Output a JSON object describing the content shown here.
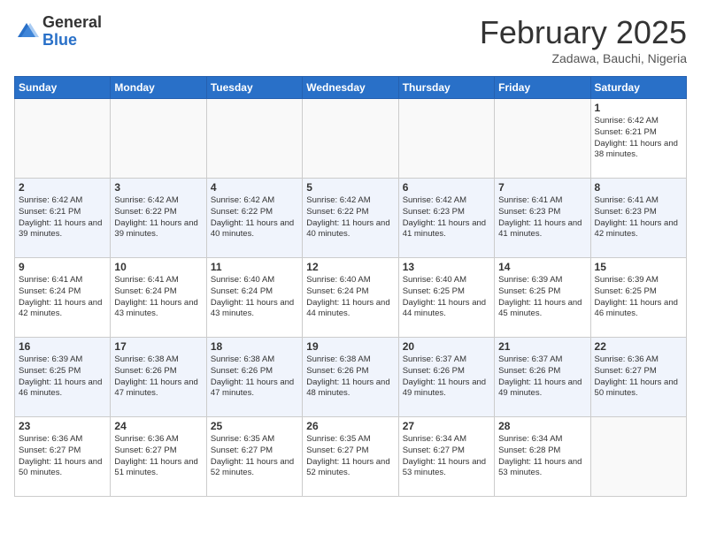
{
  "header": {
    "logo_general": "General",
    "logo_blue": "Blue",
    "month_title": "February 2025",
    "subtitle": "Zadawa, Bauchi, Nigeria"
  },
  "days_of_week": [
    "Sunday",
    "Monday",
    "Tuesday",
    "Wednesday",
    "Thursday",
    "Friday",
    "Saturday"
  ],
  "weeks": [
    {
      "alt": false,
      "days": [
        {
          "num": "",
          "info": ""
        },
        {
          "num": "",
          "info": ""
        },
        {
          "num": "",
          "info": ""
        },
        {
          "num": "",
          "info": ""
        },
        {
          "num": "",
          "info": ""
        },
        {
          "num": "",
          "info": ""
        },
        {
          "num": "1",
          "info": "Sunrise: 6:42 AM\nSunset: 6:21 PM\nDaylight: 11 hours and 38 minutes."
        }
      ]
    },
    {
      "alt": true,
      "days": [
        {
          "num": "2",
          "info": "Sunrise: 6:42 AM\nSunset: 6:21 PM\nDaylight: 11 hours and 39 minutes."
        },
        {
          "num": "3",
          "info": "Sunrise: 6:42 AM\nSunset: 6:22 PM\nDaylight: 11 hours and 39 minutes."
        },
        {
          "num": "4",
          "info": "Sunrise: 6:42 AM\nSunset: 6:22 PM\nDaylight: 11 hours and 40 minutes."
        },
        {
          "num": "5",
          "info": "Sunrise: 6:42 AM\nSunset: 6:22 PM\nDaylight: 11 hours and 40 minutes."
        },
        {
          "num": "6",
          "info": "Sunrise: 6:42 AM\nSunset: 6:23 PM\nDaylight: 11 hours and 41 minutes."
        },
        {
          "num": "7",
          "info": "Sunrise: 6:41 AM\nSunset: 6:23 PM\nDaylight: 11 hours and 41 minutes."
        },
        {
          "num": "8",
          "info": "Sunrise: 6:41 AM\nSunset: 6:23 PM\nDaylight: 11 hours and 42 minutes."
        }
      ]
    },
    {
      "alt": false,
      "days": [
        {
          "num": "9",
          "info": "Sunrise: 6:41 AM\nSunset: 6:24 PM\nDaylight: 11 hours and 42 minutes."
        },
        {
          "num": "10",
          "info": "Sunrise: 6:41 AM\nSunset: 6:24 PM\nDaylight: 11 hours and 43 minutes."
        },
        {
          "num": "11",
          "info": "Sunrise: 6:40 AM\nSunset: 6:24 PM\nDaylight: 11 hours and 43 minutes."
        },
        {
          "num": "12",
          "info": "Sunrise: 6:40 AM\nSunset: 6:24 PM\nDaylight: 11 hours and 44 minutes."
        },
        {
          "num": "13",
          "info": "Sunrise: 6:40 AM\nSunset: 6:25 PM\nDaylight: 11 hours and 44 minutes."
        },
        {
          "num": "14",
          "info": "Sunrise: 6:39 AM\nSunset: 6:25 PM\nDaylight: 11 hours and 45 minutes."
        },
        {
          "num": "15",
          "info": "Sunrise: 6:39 AM\nSunset: 6:25 PM\nDaylight: 11 hours and 46 minutes."
        }
      ]
    },
    {
      "alt": true,
      "days": [
        {
          "num": "16",
          "info": "Sunrise: 6:39 AM\nSunset: 6:25 PM\nDaylight: 11 hours and 46 minutes."
        },
        {
          "num": "17",
          "info": "Sunrise: 6:38 AM\nSunset: 6:26 PM\nDaylight: 11 hours and 47 minutes."
        },
        {
          "num": "18",
          "info": "Sunrise: 6:38 AM\nSunset: 6:26 PM\nDaylight: 11 hours and 47 minutes."
        },
        {
          "num": "19",
          "info": "Sunrise: 6:38 AM\nSunset: 6:26 PM\nDaylight: 11 hours and 48 minutes."
        },
        {
          "num": "20",
          "info": "Sunrise: 6:37 AM\nSunset: 6:26 PM\nDaylight: 11 hours and 49 minutes."
        },
        {
          "num": "21",
          "info": "Sunrise: 6:37 AM\nSunset: 6:26 PM\nDaylight: 11 hours and 49 minutes."
        },
        {
          "num": "22",
          "info": "Sunrise: 6:36 AM\nSunset: 6:27 PM\nDaylight: 11 hours and 50 minutes."
        }
      ]
    },
    {
      "alt": false,
      "days": [
        {
          "num": "23",
          "info": "Sunrise: 6:36 AM\nSunset: 6:27 PM\nDaylight: 11 hours and 50 minutes."
        },
        {
          "num": "24",
          "info": "Sunrise: 6:36 AM\nSunset: 6:27 PM\nDaylight: 11 hours and 51 minutes."
        },
        {
          "num": "25",
          "info": "Sunrise: 6:35 AM\nSunset: 6:27 PM\nDaylight: 11 hours and 52 minutes."
        },
        {
          "num": "26",
          "info": "Sunrise: 6:35 AM\nSunset: 6:27 PM\nDaylight: 11 hours and 52 minutes."
        },
        {
          "num": "27",
          "info": "Sunrise: 6:34 AM\nSunset: 6:27 PM\nDaylight: 11 hours and 53 minutes."
        },
        {
          "num": "28",
          "info": "Sunrise: 6:34 AM\nSunset: 6:28 PM\nDaylight: 11 hours and 53 minutes."
        },
        {
          "num": "",
          "info": ""
        }
      ]
    }
  ]
}
